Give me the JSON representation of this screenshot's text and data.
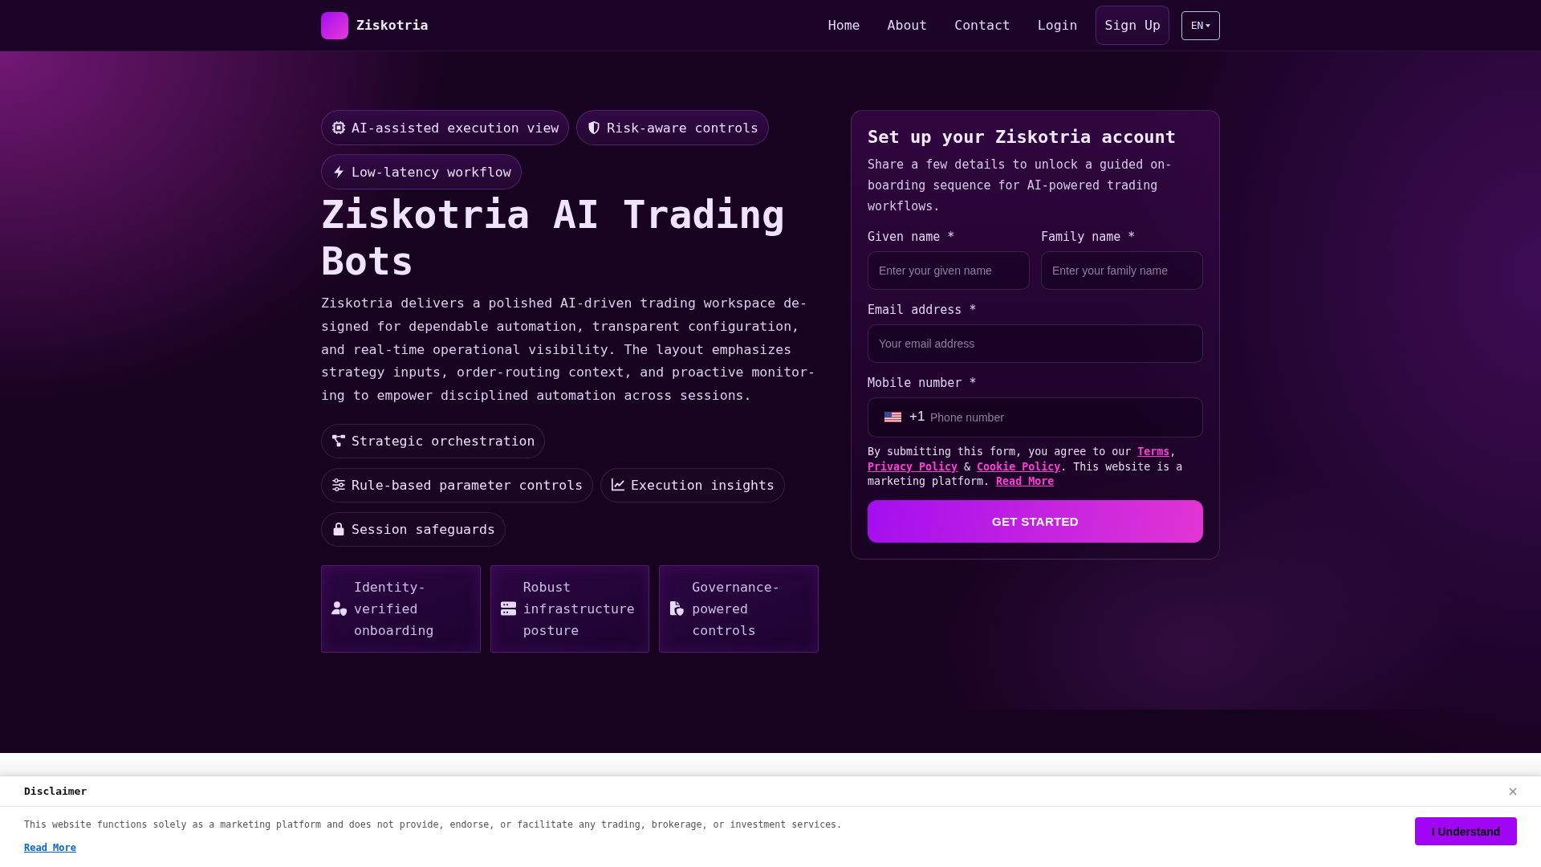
{
  "header": {
    "brand": "Ziskotria",
    "nav": [
      "Home",
      "About",
      "Contact",
      "Login"
    ],
    "sign_up": "Sign Up",
    "language": "EN"
  },
  "hero": {
    "highlights": [
      "AI-assisted execution view",
      "Risk-aware controls",
      "Low-latency workflow"
    ],
    "title": "Ziskotria AI Trading Bots",
    "description": "Ziskotria delivers a polished AI-driven trading workspace de-signed for dependable automation, transparent configuration, and real-time operational visibility. The layout emphasizes strategy inputs, order-routing context, and proactive monitor-ing to empower disciplined automation across sessions.",
    "features": [
      "Strategic orchestration",
      "Rule-based parameter controls",
      "Execution insights",
      "Session safeguards"
    ],
    "cards": [
      "Identity-verified onboarding",
      "Robust infrastructure posture",
      "Governance-powered controls"
    ]
  },
  "signup_form": {
    "title": "Set up your Ziskotria account",
    "description": "Share a few details to unlock a guided on-boarding sequence for AI-powered trading workflows.",
    "fields": [
      {
        "kind": "text",
        "label": "Given name *",
        "placeholder": "Enter your given name"
      },
      {
        "kind": "text",
        "label": "Family name *",
        "placeholder": "Enter your family name"
      },
      {
        "kind": "email",
        "label": "Email address *",
        "placeholder": "Your email address"
      },
      {
        "kind": "phone",
        "label": "Mobile number *",
        "country_code": "+1",
        "placeholder": "Phone number"
      }
    ],
    "consent": [
      {
        "kind": "text",
        "text": "By submitting this form, you agree to our "
      },
      {
        "kind": "link",
        "text": "Terms"
      },
      {
        "kind": "text",
        "text": ", "
      },
      {
        "kind": "link",
        "text": "Privacy Policy"
      },
      {
        "kind": "text",
        "text": " & "
      },
      {
        "kind": "link",
        "text": "Cookie Policy"
      },
      {
        "kind": "text",
        "text": ". This website is a marketing platform. "
      },
      {
        "kind": "link",
        "text": "Read More"
      }
    ],
    "submit": "GET STARTED"
  },
  "disclaimer": {
    "title": "Disclaimer",
    "text": "This website functions solely as a marketing platform and does not provide, endorse, or facilitate any trading, brokerage, or investment services.",
    "link": "Read More",
    "button": "I Understand"
  }
}
